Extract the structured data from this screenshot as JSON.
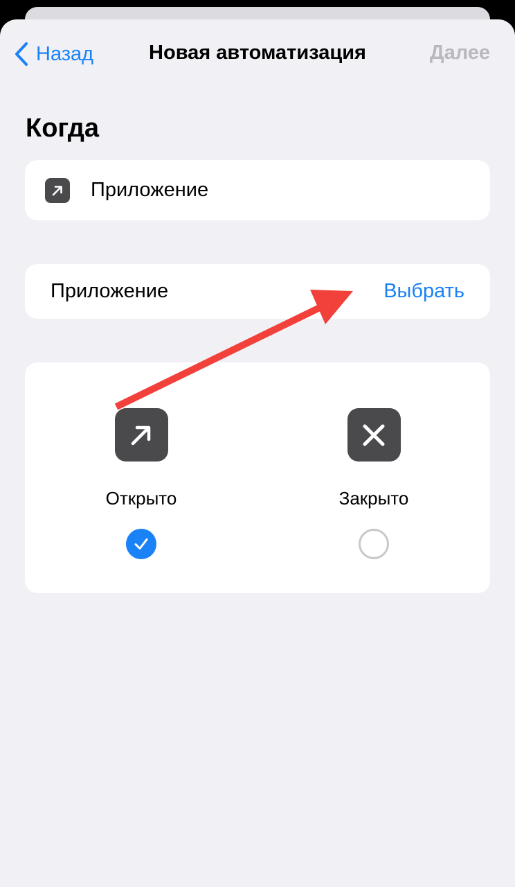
{
  "nav": {
    "back_label": "Назад",
    "title": "Новая автоматизация",
    "next_label": "Далее"
  },
  "section": {
    "title": "Когда"
  },
  "trigger": {
    "label": "Приложение",
    "icon": "arrow-up-right-icon"
  },
  "app_row": {
    "label": "Приложение",
    "action": "Выбрать"
  },
  "states": [
    {
      "label": "Открыто",
      "icon": "arrow-up-right-icon",
      "selected": true
    },
    {
      "label": "Закрыто",
      "icon": "xmark-icon",
      "selected": false
    }
  ],
  "colors": {
    "accent": "#1a82f7",
    "disabled": "#b8b8bd",
    "icon_bg": "#4a4a4d",
    "background": "#f0f0f5",
    "annotation_arrow": "#f2403a"
  }
}
